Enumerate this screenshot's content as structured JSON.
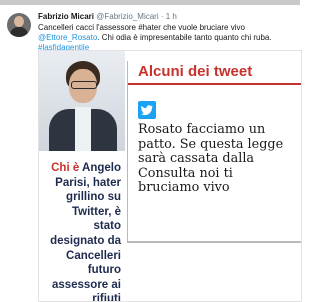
{
  "tweet": {
    "author_name": "Fabrizio Micari",
    "author_handle": "@Fabrizio_Micari",
    "timestamp": "· 1 h",
    "text_part1": "Cancelleri cacci l'assessore #hater che vuole bruciare vivo ",
    "mention": "@Ettore_Rosato",
    "text_part2": ". Chi odia è impresentabile tanto quanto chi ruba. ",
    "hashtag": "#lasfidagentile"
  },
  "card": {
    "panel_title": "Alcuni dei tweet",
    "quote": "Rosato facciamo un patto. Se questa legge sarà cassata dalla Consulta noi ti bruciamo vivo",
    "caption_lead": "Chi è",
    "caption_body": "Angelo Parisi, hater grillino su Twitter, è stato designato da Cancelleri futuro assessore ai rifiuti"
  },
  "icons": {
    "avatar": "avatar",
    "twitter": "twitter-bird-icon"
  },
  "colors": {
    "accent_red": "#c8322c",
    "twitter_blue": "#1da1f2",
    "link_blue": "#1b95e0"
  }
}
